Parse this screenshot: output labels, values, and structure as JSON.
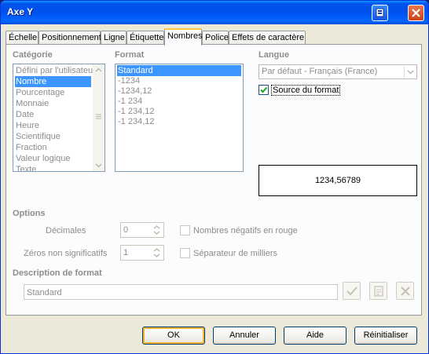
{
  "window": {
    "title": "Axe Y"
  },
  "tabs": [
    {
      "label": "Échelle"
    },
    {
      "label": "Positionnement"
    },
    {
      "label": "Ligne"
    },
    {
      "label": "Étiquette"
    },
    {
      "label": "Nombres",
      "active": true
    },
    {
      "label": "Police"
    },
    {
      "label": "Effets de caractère"
    }
  ],
  "category": {
    "heading": "Catégorie",
    "items": [
      "Défini par l'utilisateur",
      "Nombre",
      "Pourcentage",
      "Monnaie",
      "Date",
      "Heure",
      "Scientifique",
      "Fraction",
      "Valeur logique",
      "Texte"
    ],
    "selected": "Nombre"
  },
  "format": {
    "heading": "Format",
    "items": [
      "Standard",
      "-1234",
      "-1234,12",
      "-1 234",
      "-1 234,12",
      "-1 234,12"
    ],
    "selected": "Standard"
  },
  "language": {
    "heading": "Langue",
    "value": "Par défaut - Français (France)",
    "source_checkbox": "Source du format",
    "source_checked": true
  },
  "preview": {
    "value": "1234,56789"
  },
  "options": {
    "heading": "Options",
    "decimals_label": "Décimales",
    "decimals_value": "0",
    "leading_zeros_label": "Zéros non significatifs",
    "leading_zeros_value": "1",
    "negative_red_label": "Nombres négatifs en rouge",
    "thousands_sep_label": "Séparateur de milliers"
  },
  "format_code": {
    "heading": "Description de format",
    "value": "Standard"
  },
  "buttons": {
    "ok": "OK",
    "cancel": "Annuler",
    "help": "Aide",
    "reset": "Réinitialiser"
  }
}
